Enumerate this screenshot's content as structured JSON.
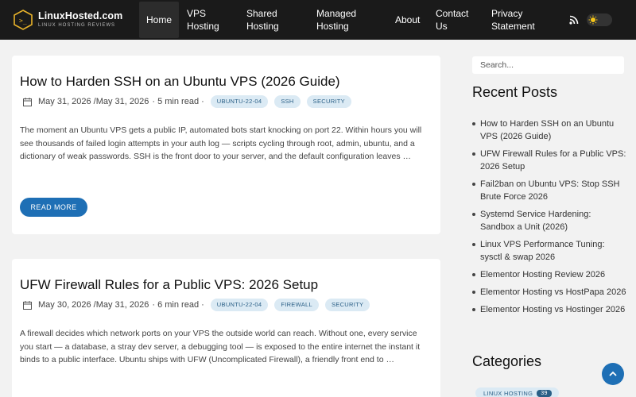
{
  "header": {
    "logo_name": "LinuxHosted.com",
    "logo_tagline": "LINUX HOSTING REVIEWS",
    "logo_icon": "terminal-prompt-hexagon",
    "nav": [
      {
        "label": "Home",
        "active": true
      },
      {
        "label": "VPS Hosting"
      },
      {
        "label": "Shared Hosting"
      },
      {
        "label": "Managed Hosting"
      },
      {
        "label": "About"
      },
      {
        "label": "Contact Us"
      },
      {
        "label": "Privacy Statement"
      }
    ]
  },
  "posts": [
    {
      "title": "How to Harden SSH on an Ubuntu VPS (2026 Guide)",
      "date": "May 31, 2026",
      "updated": "/May 31, 2026",
      "read_time": "· 5 min read ·",
      "tags": [
        "UBUNTU-22-04",
        "SSH",
        "SECURITY"
      ],
      "excerpt": "The moment an Ubuntu VPS gets a public IP, automated bots start knocking on port 22. Within hours you will see thousands of failed login attempts in your auth log — scripts cycling through root, admin, ubuntu, and a dictionary of weak passwords. SSH is the front door to your server, and the default configuration leaves …",
      "read_more": "READ MORE"
    },
    {
      "title": "UFW Firewall Rules for a Public VPS: 2026 Setup",
      "date": "May 30, 2026",
      "updated": "/May 31, 2026",
      "read_time": "· 6 min read ·",
      "tags": [
        "UBUNTU-22-04",
        "FIREWALL",
        "SECURITY"
      ],
      "excerpt": "A firewall decides which network ports on your VPS the outside world can reach. Without one, every service you start — a database, a stray dev server, a debugging tool — is exposed to the entire internet the instant it binds to a public interface. Ubuntu ships with UFW (Uncomplicated Firewall), a friendly front end to …"
    }
  ],
  "sidebar": {
    "search_placeholder": "Search...",
    "recent_heading": "Recent Posts",
    "recent_posts": [
      "How to Harden SSH on an Ubuntu VPS (2026 Guide)",
      "UFW Firewall Rules for a Public VPS: 2026 Setup",
      "Fail2ban on Ubuntu VPS: Stop SSH Brute Force 2026",
      "Systemd Service Hardening: Sandbox a Unit (2026)",
      "Linux VPS Performance Tuning: sysctl & swap 2026",
      "Elementor Hosting Review 2026",
      "Elementor Hosting vs HostPapa 2026",
      "Elementor Hosting vs Hostinger 2026"
    ],
    "categories_heading": "Categories",
    "category": {
      "label": "LINUX HOSTING",
      "count": "39"
    }
  },
  "colors": {
    "header_bg": "#1a1a1a",
    "accent": "#1e6fb5",
    "tag_bg": "#dbeaf4",
    "logo_gold": "#e8b22a"
  }
}
